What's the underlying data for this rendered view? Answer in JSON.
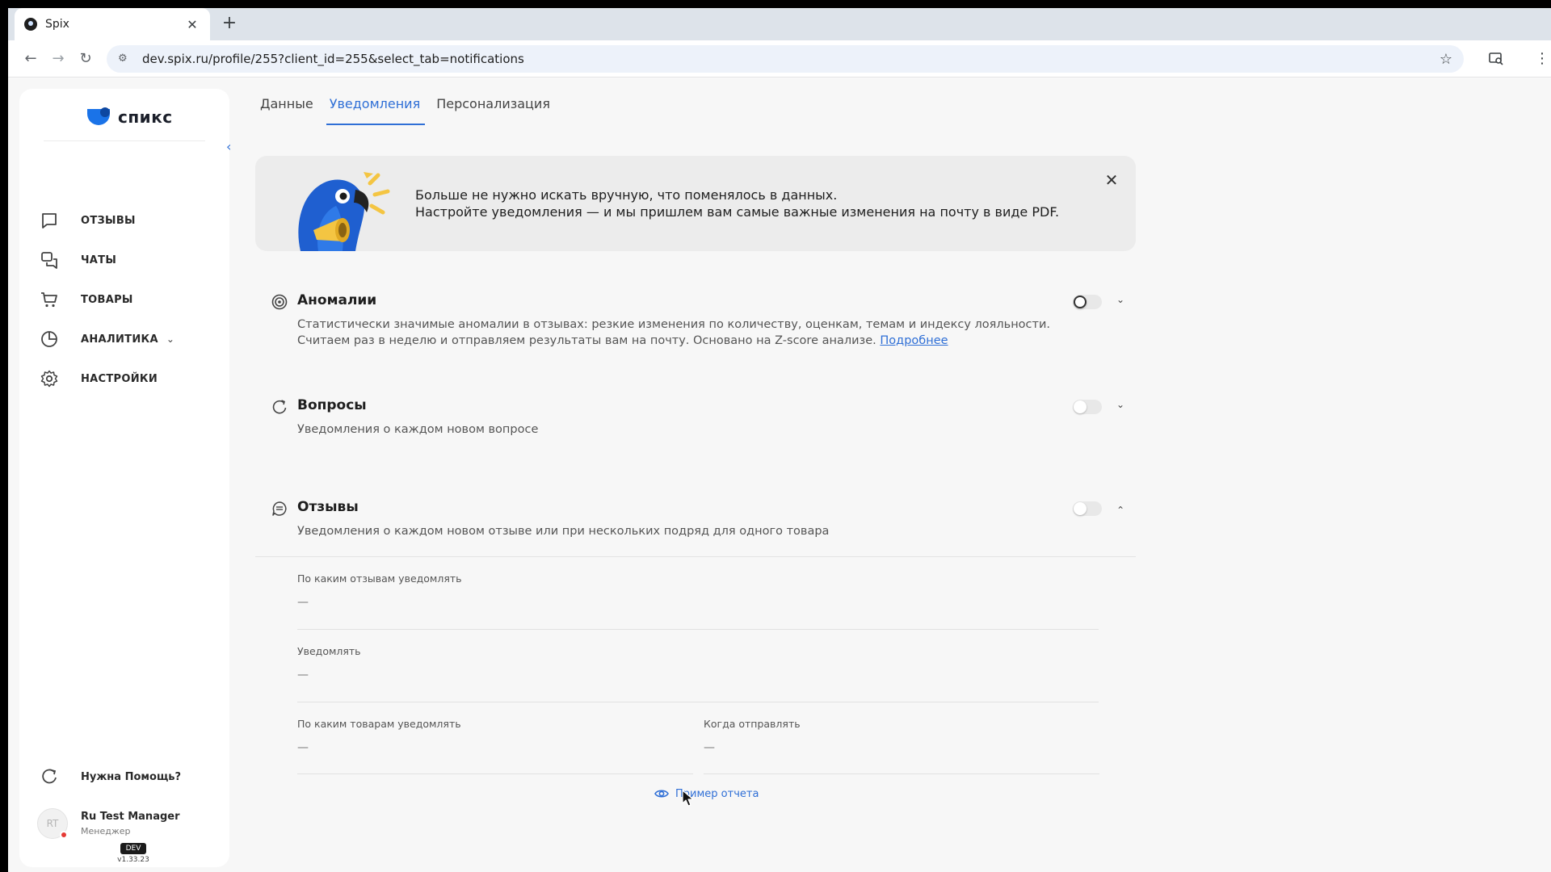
{
  "browser": {
    "tab_title": "Spix",
    "tab_close": "✕",
    "new_tab": "+",
    "url": "dev.spix.ru/profile/255?client_id=255&select_tab=notifications"
  },
  "sidebar": {
    "logo_text": "спикс",
    "items": [
      {
        "label": "ОТЗЫВЫ",
        "icon": "message-square-icon"
      },
      {
        "label": "ЧАТЫ",
        "icon": "chats-icon"
      },
      {
        "label": "ТОВАРЫ",
        "icon": "cart-icon"
      },
      {
        "label": "АНАЛИТИКА",
        "icon": "pie-chart-icon"
      },
      {
        "label": "НАСТРОЙКИ",
        "icon": "gear-icon"
      }
    ],
    "help_label": "Нужна Помощь?",
    "user": {
      "initials": "RT",
      "name": "Ru Test Manager",
      "role": "Менеджер"
    },
    "env_badge": "DEV",
    "version": "v1.33.23"
  },
  "main": {
    "tabs": [
      {
        "label": "Данные",
        "active": false
      },
      {
        "label": "Уведомления",
        "active": true
      },
      {
        "label": "Персонализация",
        "active": false
      }
    ],
    "banner": {
      "line1": "Больше не нужно искать вручную, что поменялось в данных.",
      "line2": "Настройте уведомления — и мы пришлем вам самые важные изменения на почту в виде PDF."
    },
    "sections": [
      {
        "title": "Аномалии",
        "desc": "Статистически значимые аномалии в отзывах: резкие изменения по количеству, оценкам, темам и индексу лояльности. Считаем раз в неделю и отправляем результаты вам на почту. Основано на Z-score анализе.",
        "link": "Подробнее",
        "enabled": false,
        "expanded": false
      },
      {
        "title": "Вопросы",
        "desc": "Уведомления о каждом новом вопросе",
        "enabled": false,
        "expanded": false
      },
      {
        "title": "Отзывы",
        "desc": "Уведомления о каждом новом отзыве или при нескольких подряд для одного товара",
        "enabled": false,
        "expanded": true
      }
    ],
    "review_fields": {
      "which_reviews": {
        "label": "По каким отзывам уведомлять",
        "value": "—"
      },
      "notify": {
        "label": "Уведомлять",
        "value": "—"
      },
      "which_products": {
        "label": "По каким товарам уведомлять",
        "value": "—"
      },
      "when_send": {
        "label": "Когда отправлять",
        "value": "—"
      }
    },
    "report_example": "Пример отчета"
  },
  "colors": {
    "accent": "#2f6fd6",
    "sidebar_bg": "#ffffff",
    "page_bg": "#f7f7f7",
    "banner_bg": "#ececec"
  }
}
